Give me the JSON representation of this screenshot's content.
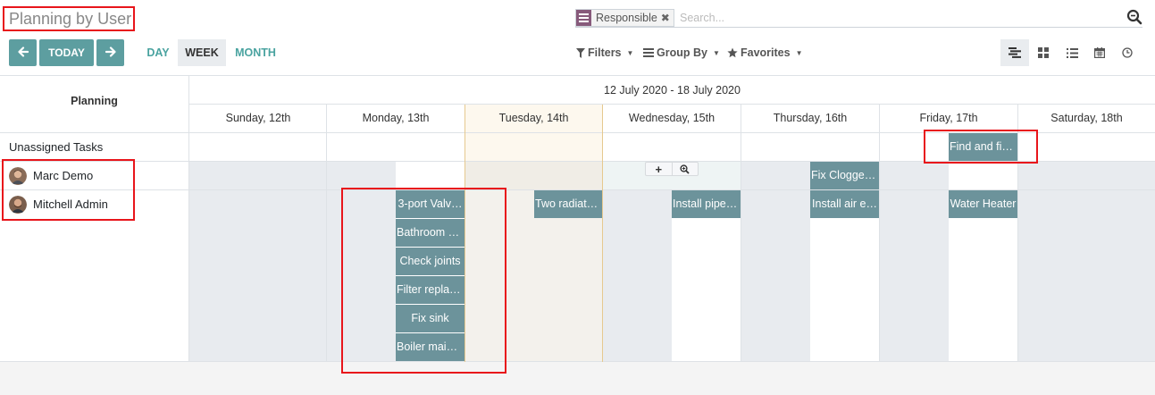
{
  "app": {
    "title": "Planning by User"
  },
  "search": {
    "facet_label": "Responsible",
    "facet_remove": "✖",
    "placeholder": "Search..."
  },
  "toolbar": {
    "today_label": "TODAY",
    "scales": [
      "DAY",
      "WEEK",
      "MONTH"
    ],
    "active_scale": "WEEK",
    "filters_label": "Filters",
    "groupby_label": "Group By",
    "favorites_label": "Favorites",
    "views": [
      "gantt-icon",
      "kanban-icon",
      "list-icon",
      "calendar-icon",
      "activity-icon"
    ],
    "active_view": "gantt-icon"
  },
  "gantt": {
    "planning_header": "Planning",
    "range_label": "12 July 2020 - 18 July 2020",
    "days": [
      "Sunday, 12th",
      "Monday, 13th",
      "Tuesday, 14th",
      "Wednesday, 15th",
      "Thursday, 16th",
      "Friday, 17th",
      "Saturday, 18th"
    ],
    "today_day": "Tuesday, 14th",
    "rows": [
      {
        "label": "Unassigned Tasks",
        "avatar": false
      },
      {
        "label": "Marc Demo",
        "avatar": true
      },
      {
        "label": "Mitchell Admin",
        "avatar": true
      }
    ],
    "hover_buttons": [
      "+",
      "zoom-icon"
    ],
    "tasks": [
      {
        "name": "Find and fix…",
        "row": "Unassigned Tasks"
      },
      {
        "name": "Fix Clogged…",
        "row": "Marc Demo"
      },
      {
        "name": "3-port Valv…",
        "row": "Mitchell Admin"
      },
      {
        "name": "Bathroom v…",
        "row": "Mitchell Admin"
      },
      {
        "name": "Check joints",
        "row": "Mitchell Admin"
      },
      {
        "name": "Filter replac…",
        "row": "Mitchell Admin"
      },
      {
        "name": "Fix sink",
        "row": "Mitchell Admin"
      },
      {
        "name": "Boiler main…",
        "row": "Mitchell Admin"
      },
      {
        "name": "Two radiato…",
        "row": "Mitchell Admin"
      },
      {
        "name": "Install pipel…",
        "row": "Mitchell Admin"
      },
      {
        "name": "Install air e…",
        "row": "Mitchell Admin"
      },
      {
        "name": "Water Heater",
        "row": "Mitchell Admin"
      }
    ]
  },
  "colors": {
    "pill": "#6c939b",
    "nav_button": "#5d9ea0",
    "link": "#4aa3a0",
    "today_column": "#fdf8ee",
    "unavailable_cell": "#e8ebef",
    "annotation_box": "#e8151b",
    "facet_icon": "#875a7b"
  }
}
